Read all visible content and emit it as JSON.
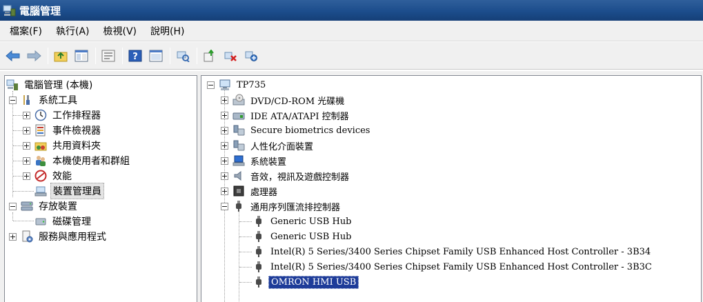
{
  "window": {
    "title": "電腦管理"
  },
  "menu": [
    "檔案(F)",
    "執行(A)",
    "檢視(V)",
    "說明(H)"
  ],
  "toolbar": {
    "buttons": [
      "back-arrow-icon",
      "forward-arrow-icon",
      "up-folder-icon",
      "show-tree-icon",
      "properties-icon",
      "help-icon",
      "console-tree-icon",
      "scan-hardware-icon",
      "update-driver-icon",
      "uninstall-icon",
      "disable-device-icon"
    ]
  },
  "left_tree": {
    "root": "電腦管理 (本機)",
    "items": [
      {
        "label": "系統工具"
      },
      {
        "label": "工作排程器"
      },
      {
        "label": "事件檢視器"
      },
      {
        "label": "共用資料夾"
      },
      {
        "label": "本機使用者和群組"
      },
      {
        "label": "效能"
      },
      {
        "label": "裝置管理員"
      },
      {
        "label": "存放裝置"
      },
      {
        "label": "磁碟管理"
      },
      {
        "label": "服務與應用程式"
      }
    ]
  },
  "right_tree": {
    "root": "TP735",
    "items": [
      {
        "label": "DVD/CD-ROM 光碟機"
      },
      {
        "label": "IDE ATA/ATAPI 控制器"
      },
      {
        "label": "Secure biometrics devices"
      },
      {
        "label": "人性化介面裝置"
      },
      {
        "label": "系統裝置"
      },
      {
        "label": "音效，視訊及遊戲控制器"
      },
      {
        "label": "處理器"
      },
      {
        "label": "通用序列匯流排控制器"
      },
      {
        "label": "Generic USB Hub"
      },
      {
        "label": "Generic USB Hub"
      },
      {
        "label": "Intel(R) 5 Series/3400 Series Chipset Family USB Enhanced Host Controller - 3B34"
      },
      {
        "label": "Intel(R) 5 Series/3400 Series Chipset Family USB Enhanced Host Controller - 3B3C"
      },
      {
        "label": "OMRON HMI USB"
      }
    ]
  },
  "colors": {
    "titlebar": "#1c4d8c",
    "selection": "#1e3c99",
    "pane_border": "#828790"
  }
}
